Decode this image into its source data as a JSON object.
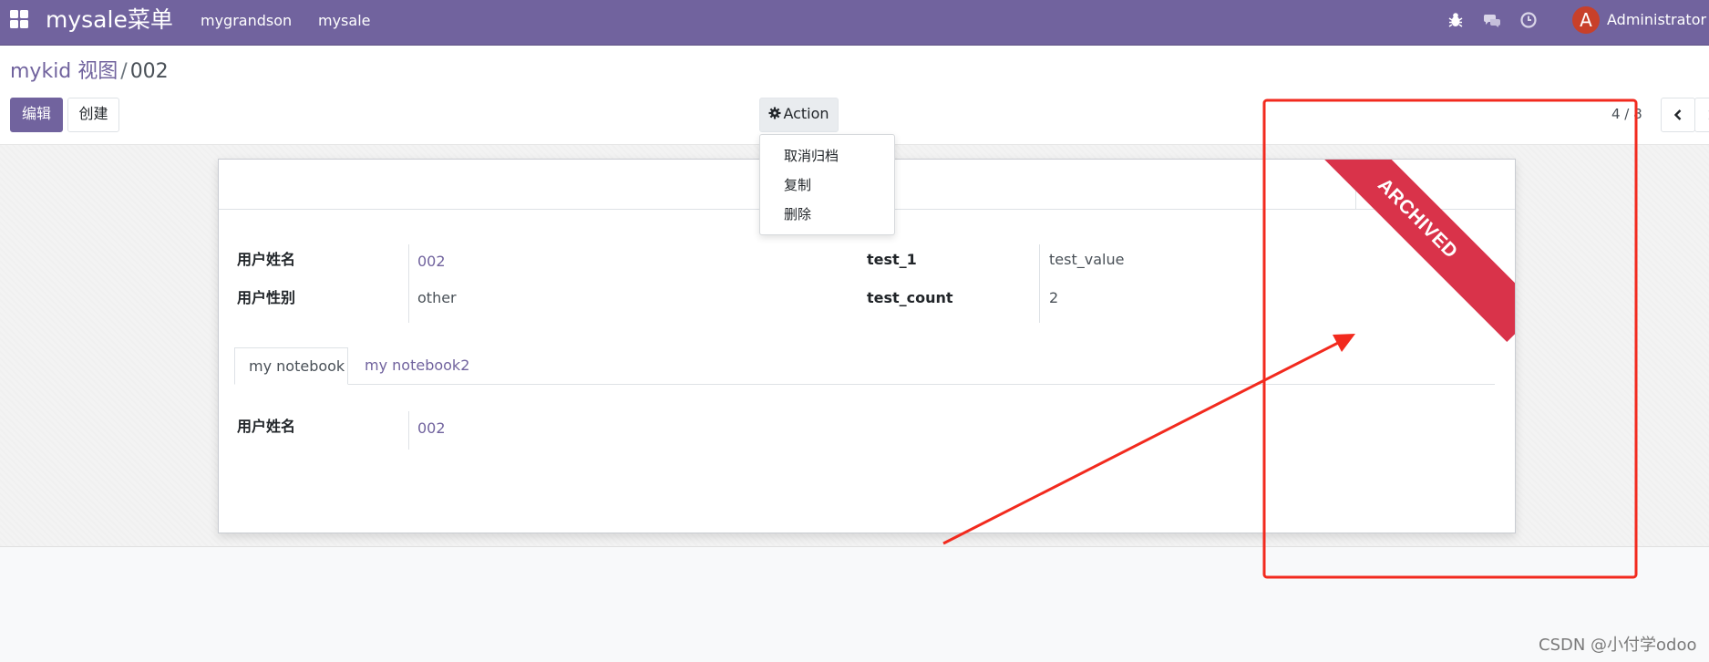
{
  "navbar": {
    "brand": "mysale菜单",
    "menu": [
      "mygrandson",
      "mysale"
    ],
    "systray_icons": [
      "bug-icon",
      "chat-icon",
      "clock-icon"
    ],
    "user_initial": "A",
    "user_name": "Administrator (f",
    "color": "#71639e"
  },
  "breadcrumb": {
    "parent": "mykid 视图",
    "separator": "/",
    "current": "002"
  },
  "buttons": {
    "edit": "编辑",
    "create": "创建",
    "action": "Action"
  },
  "pager": {
    "value": "4 / 8"
  },
  "action_menu": {
    "items": [
      "取消归档",
      "复制",
      "删除"
    ]
  },
  "form": {
    "ribbon": "ARCHIVED",
    "ribbon_color": "#d9334a",
    "fields_left": [
      {
        "label": "用户姓名",
        "value": "002"
      },
      {
        "label": "用户性别",
        "value": "other"
      }
    ],
    "fields_right": [
      {
        "label": "test_1",
        "value": "test_value"
      },
      {
        "label": "test_count",
        "value": "2"
      }
    ],
    "tabs": [
      "my notebook",
      "my notebook2"
    ],
    "tab_fields": [
      {
        "label": "用户姓名",
        "value": "002"
      }
    ]
  },
  "annotation": {
    "color": "#f22a1e"
  },
  "watermark": "CSDN @小付学odoo"
}
